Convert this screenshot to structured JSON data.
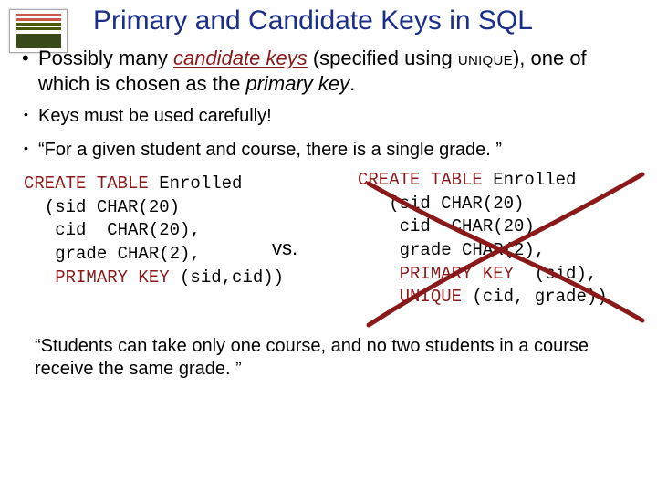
{
  "title": "Primary and Candidate Keys in SQL",
  "bullet_main_pre": "Possibly many ",
  "bullet_main_ck": "candidate keys",
  "bullet_main_mid": "  (specified using ",
  "bullet_main_unique": "UNIQUE",
  "bullet_main_post1": "), one of which is chosen as the ",
  "bullet_main_pk": "primary key",
  "bullet_main_post2": ".",
  "bullet_sub1": "Keys must be used carefully!",
  "bullet_sub2": "“For a given student and course, there is a single grade. ”",
  "vs": "vs.",
  "code_left": {
    "kw_ct": "CREATE TABLE",
    "name": " Enrolled",
    "l2": "  (sid CHAR(20)",
    "l3": "   cid  CHAR(20),",
    "l4": "   grade CHAR(2),",
    "kw_pk": "   PRIMARY KEY ",
    "l5_tail": "(sid,cid))"
  },
  "code_right": {
    "kw_ct": "CREATE TABLE",
    "name": " Enrolled",
    "l2": "   (sid CHAR(20)",
    "l3": "    cid  CHAR(20),",
    "l4": "    grade CHAR(2),",
    "kw_pk": "    PRIMARY KEY ",
    "l5_tail": " (sid),",
    "kw_uq": "    UNIQUE ",
    "l6_tail": "(cid, grade))"
  },
  "closing": "“Students can take only one course, and no two students in a course receive the same grade. ”"
}
